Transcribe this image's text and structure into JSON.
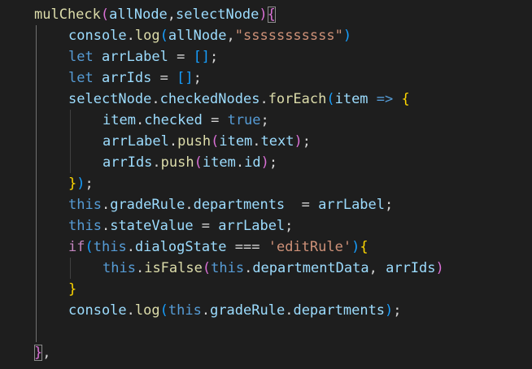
{
  "editor": {
    "theme_colors": {
      "background": "#1e1e1e",
      "function": "#dcdcaa",
      "variable": "#9cdcfe",
      "string": "#ce9178",
      "keyword": "#569cd6",
      "control": "#c586c0",
      "bracket_1": "#ffd700",
      "bracket_2": "#da70d6",
      "bracket_3": "#179fff"
    },
    "lines": [
      {
        "indent": 1,
        "tokens": [
          {
            "t": "mulCheck",
            "c": "fn"
          },
          {
            "t": "(",
            "c": "b2"
          },
          {
            "t": "allNode",
            "c": "var"
          },
          {
            "t": ",",
            "c": "plain"
          },
          {
            "t": "selectNode",
            "c": "var"
          },
          {
            "t": ")",
            "c": "b2"
          },
          {
            "t": "{",
            "c": "b2",
            "match": true
          }
        ]
      },
      {
        "indent": 2,
        "tokens": [
          {
            "t": "console",
            "c": "var"
          },
          {
            "t": ".",
            "c": "plain"
          },
          {
            "t": "log",
            "c": "fn"
          },
          {
            "t": "(",
            "c": "b3"
          },
          {
            "t": "allNode",
            "c": "var"
          },
          {
            "t": ",",
            "c": "plain"
          },
          {
            "t": "\"sssssssssss\"",
            "c": "str"
          },
          {
            "t": ")",
            "c": "b3"
          }
        ]
      },
      {
        "indent": 2,
        "tokens": [
          {
            "t": "let ",
            "c": "kw"
          },
          {
            "t": "arrLabel",
            "c": "var"
          },
          {
            "t": " = ",
            "c": "plain"
          },
          {
            "t": "[]",
            "c": "b3"
          },
          {
            "t": ";",
            "c": "plain"
          }
        ]
      },
      {
        "indent": 2,
        "tokens": [
          {
            "t": "let ",
            "c": "kw"
          },
          {
            "t": "arrIds",
            "c": "var"
          },
          {
            "t": " = ",
            "c": "plain"
          },
          {
            "t": "[]",
            "c": "b3"
          },
          {
            "t": ";",
            "c": "plain"
          }
        ]
      },
      {
        "indent": 2,
        "tokens": [
          {
            "t": "selectNode",
            "c": "var"
          },
          {
            "t": ".",
            "c": "plain"
          },
          {
            "t": "checkedNodes",
            "c": "var"
          },
          {
            "t": ".",
            "c": "plain"
          },
          {
            "t": "forEach",
            "c": "fn"
          },
          {
            "t": "(",
            "c": "b3"
          },
          {
            "t": "item",
            "c": "var"
          },
          {
            "t": " => ",
            "c": "kw"
          },
          {
            "t": "{",
            "c": "b1"
          }
        ]
      },
      {
        "indent": 3,
        "tokens": [
          {
            "t": "item",
            "c": "var"
          },
          {
            "t": ".",
            "c": "plain"
          },
          {
            "t": "checked",
            "c": "var"
          },
          {
            "t": " = ",
            "c": "plain"
          },
          {
            "t": "true",
            "c": "kw"
          },
          {
            "t": ";",
            "c": "plain"
          }
        ]
      },
      {
        "indent": 3,
        "tokens": [
          {
            "t": "arrLabel",
            "c": "var"
          },
          {
            "t": ".",
            "c": "plain"
          },
          {
            "t": "push",
            "c": "fn"
          },
          {
            "t": "(",
            "c": "b2"
          },
          {
            "t": "item",
            "c": "var"
          },
          {
            "t": ".",
            "c": "plain"
          },
          {
            "t": "text",
            "c": "var"
          },
          {
            "t": ")",
            "c": "b2"
          },
          {
            "t": ";",
            "c": "plain"
          }
        ]
      },
      {
        "indent": 3,
        "tokens": [
          {
            "t": "arrIds",
            "c": "var"
          },
          {
            "t": ".",
            "c": "plain"
          },
          {
            "t": "push",
            "c": "fn"
          },
          {
            "t": "(",
            "c": "b2"
          },
          {
            "t": "item",
            "c": "var"
          },
          {
            "t": ".",
            "c": "plain"
          },
          {
            "t": "id",
            "c": "var"
          },
          {
            "t": ")",
            "c": "b2"
          },
          {
            "t": ";",
            "c": "plain"
          }
        ]
      },
      {
        "indent": 2,
        "tokens": [
          {
            "t": "}",
            "c": "b1"
          },
          {
            "t": ")",
            "c": "b3"
          },
          {
            "t": ";",
            "c": "plain"
          }
        ]
      },
      {
        "indent": 2,
        "tokens": [
          {
            "t": "this",
            "c": "kw"
          },
          {
            "t": ".",
            "c": "plain"
          },
          {
            "t": "gradeRule",
            "c": "var"
          },
          {
            "t": ".",
            "c": "plain"
          },
          {
            "t": "departments",
            "c": "var"
          },
          {
            "t": "  = ",
            "c": "plain"
          },
          {
            "t": "arrLabel",
            "c": "var"
          },
          {
            "t": ";",
            "c": "plain"
          }
        ]
      },
      {
        "indent": 2,
        "tokens": [
          {
            "t": "this",
            "c": "kw"
          },
          {
            "t": ".",
            "c": "plain"
          },
          {
            "t": "stateValue",
            "c": "var"
          },
          {
            "t": " = ",
            "c": "plain"
          },
          {
            "t": "arrLabel",
            "c": "var"
          },
          {
            "t": ";",
            "c": "plain"
          }
        ]
      },
      {
        "indent": 2,
        "tokens": [
          {
            "t": "if",
            "c": "ctl"
          },
          {
            "t": "(",
            "c": "b3"
          },
          {
            "t": "this",
            "c": "kw"
          },
          {
            "t": ".",
            "c": "plain"
          },
          {
            "t": "dialogState",
            "c": "var"
          },
          {
            "t": " === ",
            "c": "plain"
          },
          {
            "t": "'editRule'",
            "c": "str"
          },
          {
            "t": ")",
            "c": "b3"
          },
          {
            "t": "{",
            "c": "b1"
          }
        ]
      },
      {
        "indent": 3,
        "tokens": [
          {
            "t": "this",
            "c": "kw"
          },
          {
            "t": ".",
            "c": "plain"
          },
          {
            "t": "isFalse",
            "c": "fn"
          },
          {
            "t": "(",
            "c": "b2"
          },
          {
            "t": "this",
            "c": "kw"
          },
          {
            "t": ".",
            "c": "plain"
          },
          {
            "t": "departmentData",
            "c": "var"
          },
          {
            "t": ", ",
            "c": "plain"
          },
          {
            "t": "arrIds",
            "c": "var"
          },
          {
            "t": ")",
            "c": "b2"
          }
        ]
      },
      {
        "indent": 2,
        "tokens": [
          {
            "t": "}",
            "c": "b1"
          }
        ]
      },
      {
        "indent": 2,
        "tokens": [
          {
            "t": "console",
            "c": "var"
          },
          {
            "t": ".",
            "c": "plain"
          },
          {
            "t": "log",
            "c": "fn"
          },
          {
            "t": "(",
            "c": "b3"
          },
          {
            "t": "this",
            "c": "kw"
          },
          {
            "t": ".",
            "c": "plain"
          },
          {
            "t": "gradeRule",
            "c": "var"
          },
          {
            "t": ".",
            "c": "plain"
          },
          {
            "t": "departments",
            "c": "var"
          },
          {
            "t": ")",
            "c": "b3"
          },
          {
            "t": ";",
            "c": "plain"
          }
        ]
      },
      {
        "indent": 0,
        "tokens": []
      },
      {
        "indent": 1,
        "tokens": [
          {
            "t": "}",
            "c": "b2",
            "match": true
          },
          {
            "t": ",",
            "c": "plain"
          }
        ]
      }
    ]
  }
}
